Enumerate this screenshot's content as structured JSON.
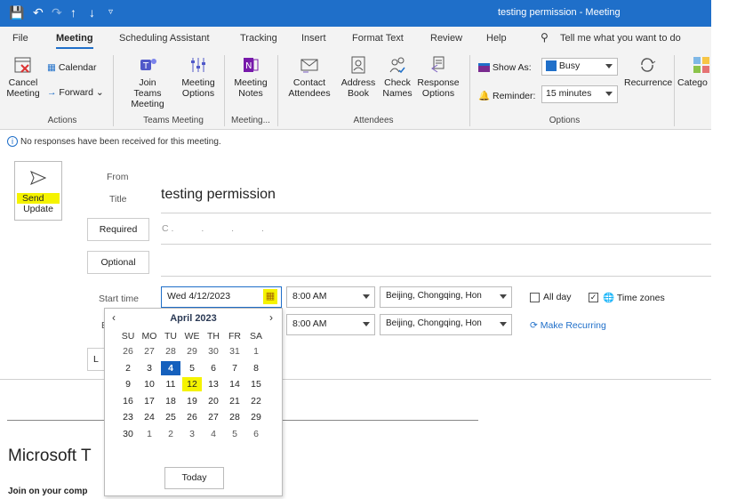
{
  "window": {
    "title": "testing permission  -  Meeting"
  },
  "tabs": [
    "File",
    "Meeting",
    "Scheduling Assistant",
    "Tracking",
    "Insert",
    "Format Text",
    "Review",
    "Help"
  ],
  "tell_me": "Tell me what you want to do",
  "ribbon": {
    "cancel": "Cancel Meeting",
    "calendar": "Calendar",
    "forward": "Forward",
    "actions": "Actions",
    "join_teams": "Join Teams Meeting",
    "meeting_options": "Meeting Options",
    "teams_meeting": "Teams Meeting",
    "meeting_notes": "Meeting Notes",
    "meeting_group": "Meeting...",
    "contact_attendees": "Contact Attendees",
    "address_book": "Address Book",
    "check_names": "Check Names",
    "response_options": "Response Options",
    "attendees": "Attendees",
    "show_as_label": "Show As:",
    "show_as_value": "Busy",
    "reminder_label": "Reminder:",
    "reminder_value": "15 minutes",
    "recurrence": "Recurrence",
    "options": "Options",
    "categorize": "Catego"
  },
  "info_bar": "No responses have been received for this meeting.",
  "send": {
    "line1": "Send",
    "line2": "Update"
  },
  "form": {
    "from_label": "From",
    "title_label": "Title",
    "title_value": "testing permission",
    "required": "Required",
    "required_value": "C",
    "optional": "Optional",
    "start_label": "Start time",
    "end_label": "E",
    "start_date": "Wed 4/12/2023",
    "start_time": "8:00 AM",
    "end_time": "8:00 AM",
    "timezone": "Beijing, Chongqing, Hon",
    "all_day": "All day",
    "time_zones": "Time zones",
    "make_recurring": "Make Recurring",
    "location_label": "L"
  },
  "calendar": {
    "month": "April 2023",
    "dow": [
      "SU",
      "MO",
      "TU",
      "WE",
      "TH",
      "FR",
      "SA"
    ],
    "weeks": [
      [
        "26",
        "27",
        "28",
        "29",
        "30",
        "31",
        "1"
      ],
      [
        "2",
        "3",
        "4",
        "5",
        "6",
        "7",
        "8"
      ],
      [
        "9",
        "10",
        "11",
        "12",
        "13",
        "14",
        "15"
      ],
      [
        "16",
        "17",
        "18",
        "19",
        "20",
        "21",
        "22"
      ],
      [
        "23",
        "24",
        "25",
        "26",
        "27",
        "28",
        "29"
      ],
      [
        "30",
        "1",
        "2",
        "3",
        "4",
        "5",
        "6"
      ]
    ],
    "today": "Today"
  },
  "body": {
    "heading": "Microsoft T",
    "join": "Join on your comp"
  }
}
